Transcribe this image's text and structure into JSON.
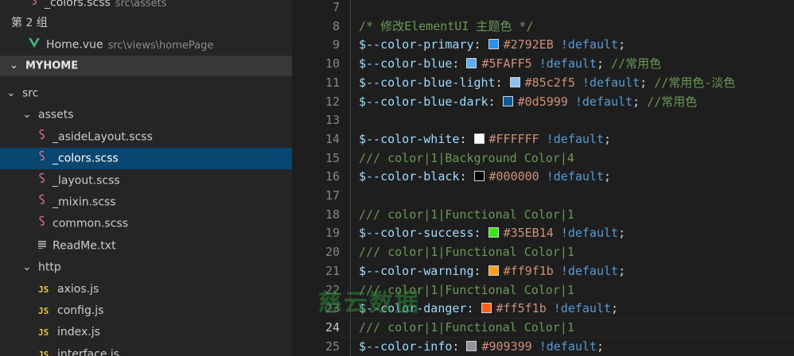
{
  "sidebar": {
    "open_editors": [
      {
        "name": "_colors.scss",
        "path": "src\\assets",
        "icon": "sass-icon"
      },
      {
        "name": "Home.vue",
        "path": "src\\views\\homePage",
        "icon": "vue-icon"
      }
    ],
    "group_label": "第 2 组",
    "section_title": "MYHOME",
    "tree": [
      {
        "label": "src",
        "type": "folder",
        "expanded": true,
        "depth": 0
      },
      {
        "label": "assets",
        "type": "folder",
        "expanded": true,
        "depth": 1
      },
      {
        "label": "_asideLayout.scss",
        "type": "sass",
        "depth": 2
      },
      {
        "label": "_colors.scss",
        "type": "sass",
        "depth": 2,
        "selected": true
      },
      {
        "label": "_layout.scss",
        "type": "sass",
        "depth": 2
      },
      {
        "label": "_mixin.scss",
        "type": "sass",
        "depth": 2
      },
      {
        "label": "common.scss",
        "type": "sass",
        "depth": 2
      },
      {
        "label": "ReadMe.txt",
        "type": "txt",
        "depth": 2
      },
      {
        "label": "http",
        "type": "folder",
        "expanded": true,
        "depth": 1
      },
      {
        "label": "axios.js",
        "type": "js",
        "depth": 2
      },
      {
        "label": "config.js",
        "type": "js",
        "depth": 2
      },
      {
        "label": "index.js",
        "type": "js",
        "depth": 2
      },
      {
        "label": "interface.js",
        "type": "js",
        "depth": 2
      }
    ]
  },
  "editor": {
    "line_numbers": [
      "7",
      "8",
      "9",
      "10",
      "11",
      "12",
      "13",
      "14",
      "15",
      "16",
      "17",
      "18",
      "19",
      "20",
      "21",
      "22",
      "23",
      "24",
      "25"
    ],
    "active_line": "24",
    "lines": [
      {
        "type": "empty"
      },
      {
        "type": "comment",
        "text": "/* 修改ElementUI 主题色 */"
      },
      {
        "type": "var",
        "name": "$--color-primary",
        "swatch": "#2792EB",
        "value": "#2792EB",
        "flag": "!default",
        "comment": ""
      },
      {
        "type": "var",
        "name": "$--color-blue",
        "swatch": "#5FAFF5",
        "value": "#5FAFF5",
        "flag": "!default",
        "comment": "//常用色"
      },
      {
        "type": "var",
        "name": "$--color-blue-light",
        "swatch": "#85c2f5",
        "value": "#85c2f5",
        "flag": "!default",
        "comment": "//常用色-淡色"
      },
      {
        "type": "var",
        "name": "$--color-blue-dark",
        "swatch": "#0d5999",
        "value": "#0d5999",
        "flag": "!default",
        "comment": "//常用色"
      },
      {
        "type": "empty"
      },
      {
        "type": "var",
        "name": "$--color-white",
        "swatch": "#FFFFFF",
        "value": "#FFFFFF",
        "flag": "!default",
        "comment": ""
      },
      {
        "type": "comment",
        "text": "/// color|1|Background Color|4"
      },
      {
        "type": "var",
        "name": "$--color-black",
        "swatch": "#000000",
        "value": "#000000",
        "flag": "!default",
        "comment": ""
      },
      {
        "type": "empty"
      },
      {
        "type": "comment",
        "text": "/// color|1|Functional Color|1"
      },
      {
        "type": "var",
        "name": "$--color-success",
        "swatch": "#35EB14",
        "value": "#35EB14",
        "flag": "!default",
        "comment": ""
      },
      {
        "type": "comment",
        "text": "/// color|1|Functional Color|1"
      },
      {
        "type": "var",
        "name": "$--color-warning",
        "swatch": "#ff9f1b",
        "value": "#ff9f1b",
        "flag": "!default",
        "comment": ""
      },
      {
        "type": "comment",
        "text": "/// color|1|Functional Color|1"
      },
      {
        "type": "var",
        "name": "$--color-danger",
        "swatch": "#ff5f1b",
        "value": "#ff5f1b",
        "flag": "!default",
        "comment": ""
      },
      {
        "type": "comment",
        "text": "/// color|1|Functional Color|1"
      },
      {
        "type": "var",
        "name": "$--color-info",
        "swatch": "#909399",
        "value": "#909399",
        "flag": "!default",
        "comment": ""
      }
    ]
  },
  "watermark": "慈云数据",
  "colors": {
    "selection": "#094771",
    "sass_icon": "#c76494",
    "vue_icon": "#41b883",
    "js_icon": "#e6c84d"
  }
}
